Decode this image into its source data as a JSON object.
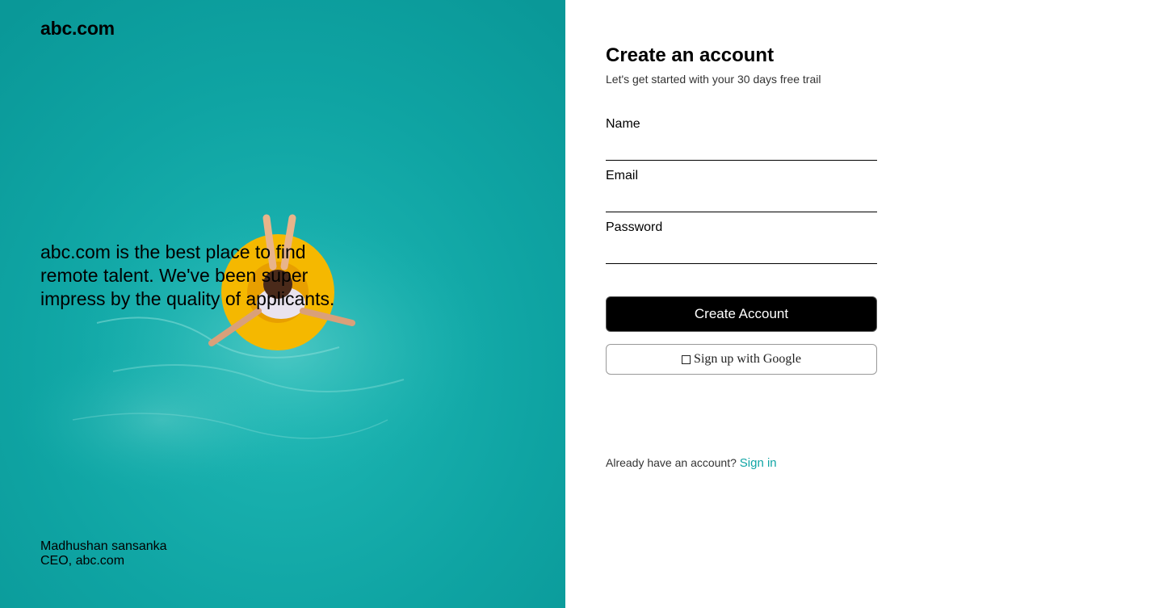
{
  "brand": {
    "name": "abc.com"
  },
  "testimonial": {
    "quote": "abc.com is the best place to find remote talent. We've been super impress by the quality of applicants.",
    "author_name": "Madhushan sansanka",
    "author_title": "CEO, abc.com"
  },
  "form": {
    "title": "Create an account",
    "subtitle": "Let's get started with your 30 days free trail",
    "name_label": "Name",
    "name_value": "",
    "email_label": "Email",
    "email_value": "",
    "password_label": "Password",
    "password_value": "",
    "create_button": "Create Account",
    "google_button": "Sign up with Google",
    "signin_prompt": "Already have an account?",
    "signin_link": "Sign in"
  },
  "colors": {
    "water": "#12a5a5",
    "accent": "#10a5a5",
    "float": "#f5b800",
    "button_bg": "#000000"
  },
  "icons": {
    "google": "google-icon"
  }
}
